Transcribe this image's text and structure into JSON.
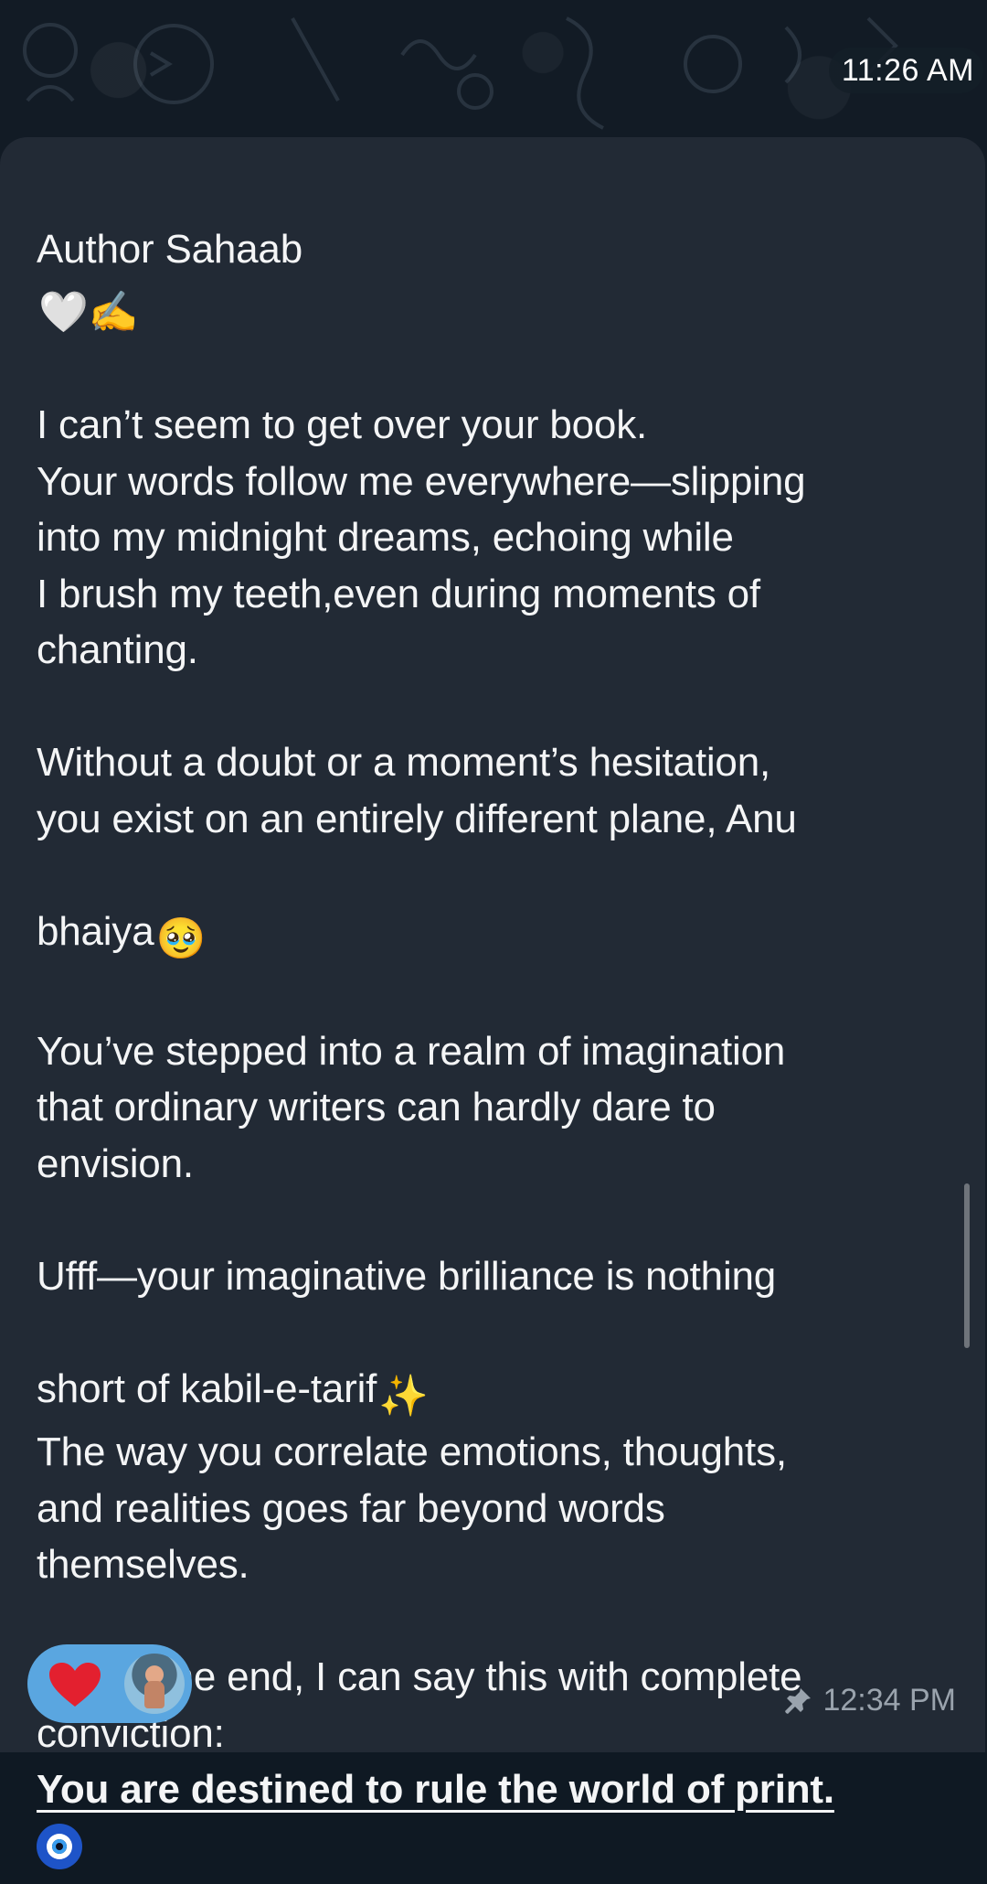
{
  "header": {
    "time": "11:26 AM"
  },
  "message": {
    "lines": [
      "Author Sahaab",
      "",
      "I can’t seem to get over your book.",
      "Your words follow me everywhere—slipping",
      "into my midnight dreams, echoing while",
      "I brush my teeth,even during moments of",
      "chanting.",
      "",
      "Without a doubt or a moment’s hesitation,",
      "you exist on an entirely different plane, Anu",
      "bhaiya",
      "",
      "You’ve stepped into a realm of imagination",
      "that ordinary writers can hardly dare to",
      "envision.",
      "",
      "Ufff—your imaginative brilliance is nothing",
      "short of kabil-e-tarif",
      "The way you correlate emotions, thoughts,",
      "and realities goes far beyond words",
      "themselves.",
      "",
      "And in the end, I can say this with complete",
      "conviction:",
      "You are destined to rule the world of print."
    ],
    "emojis": {
      "greeting": "🤍✍️",
      "bhaiya": "🥹",
      "sparkles": "✨"
    }
  },
  "reactions": {
    "icon": "heart-icon",
    "color": "#5aa6e0"
  },
  "footer": {
    "time": "12:34 PM",
    "pin_icon": "pin-icon"
  },
  "colors": {
    "background": "#121b25",
    "bubble": "#222a35",
    "text": "#f4f5f6",
    "meta": "#9aa3ad"
  }
}
